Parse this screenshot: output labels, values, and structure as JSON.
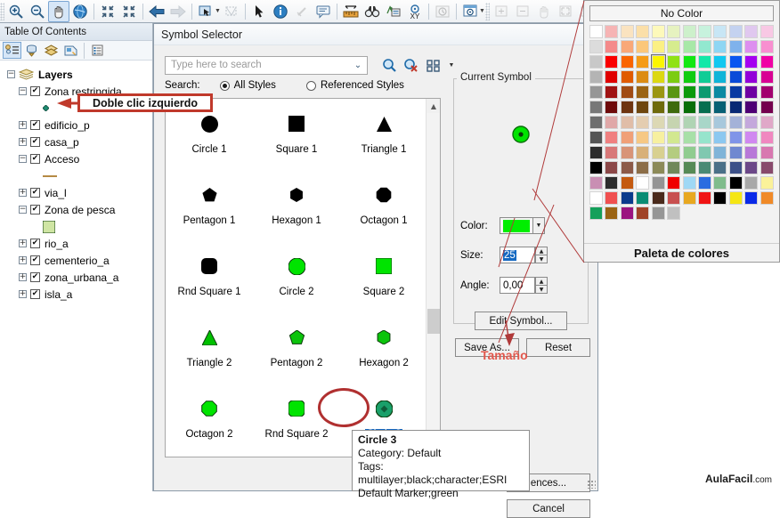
{
  "toolbar": {
    "buttons": [
      {
        "name": "zoom-in-icon",
        "label": "Zoom In",
        "selected": false
      },
      {
        "name": "zoom-out-icon",
        "label": "Zoom Out",
        "selected": false
      },
      {
        "name": "pan-hand-icon",
        "label": "Pan",
        "selected": true
      },
      {
        "name": "full-extent-globe-icon",
        "label": "Full Extent",
        "selected": false
      },
      {
        "name": "fixed-zoom-in-icon",
        "label": "Fixed Zoom In",
        "selected": false
      },
      {
        "name": "fixed-zoom-out-icon",
        "label": "Fixed Zoom Out",
        "selected": false
      },
      {
        "name": "go-back-arrow-icon",
        "label": "Go Back To Previous Extent",
        "selected": false
      },
      {
        "name": "go-forward-arrow-icon",
        "label": "Go To Next Extent",
        "selected": false
      },
      {
        "name": "select-features-icon",
        "label": "Select Features",
        "selected": false
      },
      {
        "name": "select-by-rectangle-icon",
        "label": "Select By Graphics",
        "selected": false
      },
      {
        "name": "select-elements-arrow-icon",
        "label": "Select Elements",
        "selected": false
      },
      {
        "name": "identify-icon",
        "label": "Identify",
        "selected": false
      },
      {
        "name": "hyperlink-icon",
        "label": "Hyperlink",
        "selected": false
      },
      {
        "name": "html-popup-icon",
        "label": "HTML Popup",
        "selected": false
      },
      {
        "name": "measure-icon",
        "label": "Measure",
        "selected": false
      },
      {
        "name": "find-binoculars-icon",
        "label": "Find",
        "selected": false
      },
      {
        "name": "find-route-icon",
        "label": "Find Route",
        "selected": false
      },
      {
        "name": "go-to-xy-icon",
        "label": "Go To XY",
        "selected": false
      },
      {
        "name": "time-slider-icon",
        "label": "Time Slider",
        "selected": false
      },
      {
        "name": "create-viewer-window-icon",
        "label": "Create Viewer Window",
        "selected": false
      },
      {
        "name": "zoom-in-page-icon",
        "label": "Zoom In Page",
        "selected": false
      },
      {
        "name": "zoom-out-page-icon",
        "label": "Zoom Out Page",
        "selected": false
      },
      {
        "name": "pan-page-icon",
        "label": "Pan Page",
        "selected": false
      },
      {
        "name": "zoom-whole-page-icon",
        "label": "Zoom Whole Page",
        "selected": false
      },
      {
        "name": "scale-1to1-icon",
        "label": "1:1",
        "selected": false
      }
    ]
  },
  "toc": {
    "title": "Table Of Contents",
    "tools": [
      {
        "name": "list-by-drawing-order-icon",
        "label": "List By Drawing Order",
        "selected": true
      },
      {
        "name": "list-by-source-icon",
        "label": "List By Source",
        "selected": false
      },
      {
        "name": "list-by-visibility-icon",
        "label": "List By Visibility",
        "selected": false
      },
      {
        "name": "list-by-selection-icon",
        "label": "List By Selection",
        "selected": false
      },
      {
        "name": "options-icon",
        "label": "Options",
        "selected": false
      }
    ],
    "root": "Layers",
    "layers": [
      {
        "label": "Zona restringida",
        "expander": "-",
        "checked": true,
        "indent": 1,
        "symbol": {
          "shape": "diamond",
          "color": "#1e8c72",
          "size": 7
        }
      },
      {
        "label": "edificio_p",
        "expander": "+",
        "checked": true,
        "indent": 1,
        "symbol": null
      },
      {
        "label": "casa_p",
        "expander": "+",
        "checked": true,
        "indent": 1,
        "symbol": null
      },
      {
        "label": "Acceso",
        "expander": "-",
        "checked": true,
        "indent": 1,
        "symbol": {
          "shape": "line",
          "color": "#b58a44",
          "size": 16
        }
      },
      {
        "label": "via_l",
        "expander": "+",
        "checked": true,
        "indent": 1,
        "symbol": null
      },
      {
        "label": "Zona de pesca",
        "expander": "-",
        "checked": true,
        "indent": 1,
        "symbol": {
          "shape": "square",
          "color": "#cfe5a3",
          "size": 14
        }
      },
      {
        "label": "rio_a",
        "expander": "+",
        "checked": true,
        "indent": 1,
        "symbol": null
      },
      {
        "label": "cementerio_a",
        "expander": "+",
        "checked": true,
        "indent": 1,
        "symbol": null
      },
      {
        "label": "zona_urbana_a",
        "expander": "+",
        "checked": true,
        "indent": 1,
        "symbol": null
      },
      {
        "label": "isla_a",
        "expander": "+",
        "checked": true,
        "indent": 1,
        "symbol": null
      }
    ]
  },
  "dialog": {
    "title": "Symbol Selector",
    "search": {
      "placeholder": "Type here to search",
      "value": "",
      "label": "Search:",
      "options": [
        {
          "label": "All Styles",
          "selected": true
        },
        {
          "label": "Referenced Styles",
          "selected": false
        }
      ],
      "icons": [
        "search-icon",
        "clear-search-icon",
        "view-mode-icon",
        "view-mode-dropdown-icon"
      ]
    },
    "symbols": [
      {
        "name": "Circle 1",
        "shape": "circle",
        "color": "#000000",
        "size": 19,
        "selected": false
      },
      {
        "name": "Square 1",
        "shape": "square",
        "color": "#000000",
        "size": 18,
        "selected": false
      },
      {
        "name": "Triangle 1",
        "shape": "triangle",
        "color": "#000000",
        "size": 17,
        "selected": false
      },
      {
        "name": "Pentagon 1",
        "shape": "pentagon",
        "color": "#000000",
        "size": 17,
        "selected": false
      },
      {
        "name": "Hexagon 1",
        "shape": "hexagon",
        "color": "#000000",
        "size": 16,
        "selected": false
      },
      {
        "name": "Octagon 1",
        "shape": "octagon",
        "color": "#000000",
        "size": 18,
        "selected": false
      },
      {
        "name": "Rnd Square 1",
        "shape": "rndsquare",
        "color": "#000000",
        "size": 18,
        "selected": false
      },
      {
        "name": "Circle 2",
        "shape": "circle",
        "color": "#00e400",
        "size": 19,
        "selected": false
      },
      {
        "name": "Square 2",
        "shape": "square",
        "color": "#00e400",
        "size": 18,
        "selected": false
      },
      {
        "name": "Triangle 2",
        "shape": "triangle",
        "color": "#00c000",
        "size": 17,
        "selected": false
      },
      {
        "name": "Pentagon 2",
        "shape": "pentagon",
        "color": "#0cc40c",
        "size": 17,
        "selected": false
      },
      {
        "name": "Hexagon 2",
        "shape": "hexagon",
        "color": "#0cc40c",
        "size": 16,
        "selected": false
      },
      {
        "name": "Octagon 2",
        "shape": "octagon",
        "color": "#00e400",
        "size": 18,
        "selected": false
      },
      {
        "name": "Rnd Square 2",
        "shape": "rndsquare",
        "color": "#00e400",
        "size": 18,
        "selected": false
      },
      {
        "name": "Circle 3",
        "shape": "circle3",
        "color": "#1aa06a",
        "size": 19,
        "selected": true
      }
    ],
    "current_symbol": {
      "legend": "Current Symbol",
      "preview_shape": "circle3",
      "preview_color": "#00e400"
    },
    "fields": {
      "color_label": "Color:",
      "color_value": "#00ee00",
      "size_label": "Size:",
      "size_value": "25",
      "angle_label": "Angle:",
      "angle_value": "0,00"
    },
    "buttons": {
      "edit_symbol": "Edit Symbol...",
      "save_as": "Save As...",
      "reset": "Reset",
      "style_references": "ences...",
      "cancel": "Cancel",
      "ok": ""
    }
  },
  "palette": {
    "no_color": "No Color",
    "caption": "Paleta de colores",
    "rows": [
      [
        "#ffffff",
        "#f6b4b4",
        "#fae3c0",
        "#fbdfa8",
        "#fdf9bb",
        "#e6f2c0",
        "#cdf0cb",
        "#c7f2dd",
        "#c8e6f5",
        "#c4d2f0",
        "#e0c8ef",
        "#f8c8e4"
      ],
      [
        "#dcdcdc",
        "#f48a8a",
        "#f9a878",
        "#fbc77a",
        "#fbf084",
        "#d6ec8e",
        "#a8e8a8",
        "#92e8cf",
        "#8fd6f3",
        "#7fb2ec",
        "#dd8fef",
        "#f88fd0"
      ],
      [
        "#c8c8c8",
        "#fa0000",
        "#fa6400",
        "#f59b16",
        "#fbf500",
        "#8fe215",
        "#12e812",
        "#12e8a8",
        "#12c8f0",
        "#0a56f0",
        "#a500f0",
        "#f000a5"
      ],
      [
        "#b4b4b4",
        "#e00000",
        "#e05a00",
        "#dc8c14",
        "#dcd812",
        "#7ccc12",
        "#10cc10",
        "#10cc96",
        "#10b4d8",
        "#0a4ad8",
        "#9300d8",
        "#d80093"
      ],
      [
        "#969696",
        "#a01414",
        "#a04b14",
        "#9b6414",
        "#9b9612",
        "#5a9612",
        "#0c9a0c",
        "#0c9a70",
        "#0c8aa2",
        "#0a3aa2",
        "#6e00a2",
        "#a2006e"
      ],
      [
        "#787878",
        "#6e0a0a",
        "#6e3410",
        "#6e460f",
        "#6e6a0c",
        "#3e6a0c",
        "#086e08",
        "#086e50",
        "#086074",
        "#082874",
        "#4e0074",
        "#74004e"
      ],
      [
        "#6e6e6e",
        "#e0a8a8",
        "#e0bda8",
        "#e4cdb0",
        "#dcd8b4",
        "#c6d4b0",
        "#b0d4b4",
        "#a8d6c8",
        "#a8c8dc",
        "#a4b2d8",
        "#c4a8dc",
        "#e0a8c8"
      ],
      [
        "#555555",
        "#f08080",
        "#f0a078",
        "#f6c884",
        "#f7f0a0",
        "#d2e890",
        "#a8e0a8",
        "#96e4cc",
        "#8cc8f0",
        "#8094e8",
        "#d088f0",
        "#f088c0"
      ],
      [
        "#2d2d2d",
        "#d87878",
        "#d89478",
        "#d8b078",
        "#d8d090",
        "#b4cc80",
        "#90cc90",
        "#80c8b0",
        "#80b4d8",
        "#7088d0",
        "#b878d8",
        "#d878b0"
      ],
      [
        "#000000",
        "#8c4848",
        "#8c5a48",
        "#8c6e48",
        "#8c8a58",
        "#70885a",
        "#568a56",
        "#4a8a74",
        "#4a7088",
        "#3c5088",
        "#6c4888",
        "#884a6c"
      ],
      [
        "#c98fb3",
        "#2d2d2d",
        "#c45a10",
        "#ffffff",
        "#949494",
        "#f00000",
        "#9fd8f5",
        "#2a6ce0",
        "#80bc8c",
        "#000000",
        "#a8a8a8",
        "#fbf29a"
      ],
      [
        "#ffffff",
        "#f05050",
        "#0a3a8c",
        "#0a8c74",
        "#4a2a1c",
        "#c85050",
        "#e8a820",
        "#f01414",
        "#000000",
        "#f5e614",
        "#0a2ae8",
        "#f08a28"
      ],
      [
        "#14a05a",
        "#9b6414",
        "#9b1480",
        "#a04428",
        "#969696",
        "#c0c0c0",
        "",
        "",
        "",
        "",
        "",
        ""
      ]
    ],
    "highlighted": {
      "row": 2,
      "col": 4
    }
  },
  "tooltip": {
    "title": "Circle 3",
    "lines": [
      "Category: Default",
      "Tags: multilayer;black;character;ESRI",
      "Default Marker;green"
    ]
  },
  "annotations": {
    "doble_clic": "Doble clic izquierdo",
    "tamano": "Tamaño",
    "watermark": "AulaFacil",
    "watermark_dom": ".com"
  }
}
